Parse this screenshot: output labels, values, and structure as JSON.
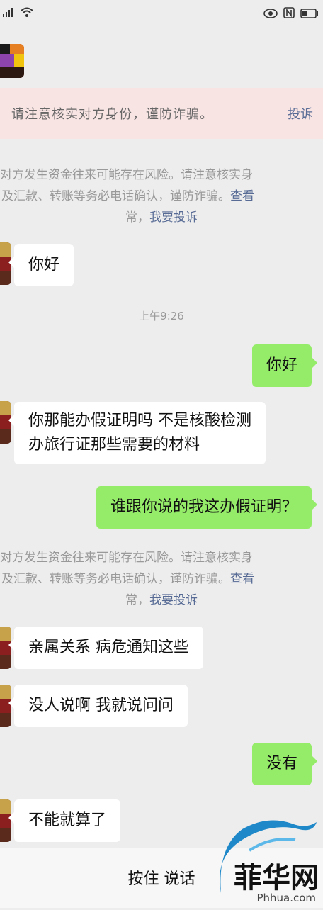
{
  "status_bar": {
    "signal": "4G",
    "battery": ""
  },
  "banner": {
    "text": "请注意核实对方身份，谨防诈骗。",
    "link": "投诉"
  },
  "system_notice": {
    "line1": "对方发生资金往来可能存在风险。请注意核实身",
    "line2_text": "及汇款、转账等务必电话确认，谨防诈骗。",
    "line2_link": "查看",
    "line3_text": "常，",
    "line3_link": "我要投诉"
  },
  "timestamp": "上午9:26",
  "messages": [
    {
      "side": "in",
      "text": "你好"
    },
    {
      "side": "out",
      "text": "你好"
    },
    {
      "side": "in",
      "text1": "你那能办假证明吗  不是核酸检测",
      "text2": "办旅行证那些需要的材料"
    },
    {
      "side": "out",
      "text": "谁跟你说的我这办假证明？"
    },
    {
      "side": "in",
      "text": "亲属关系  病危通知这些"
    },
    {
      "side": "in",
      "text": "没人说啊  我就说问问"
    },
    {
      "side": "out",
      "text": "没有"
    },
    {
      "side": "in",
      "text": "不能就算了"
    }
  ],
  "input_bar": {
    "hold_to_talk": "按住 说话"
  },
  "watermark": {
    "logo_text": "菲华网",
    "site": "Phhua.com"
  }
}
